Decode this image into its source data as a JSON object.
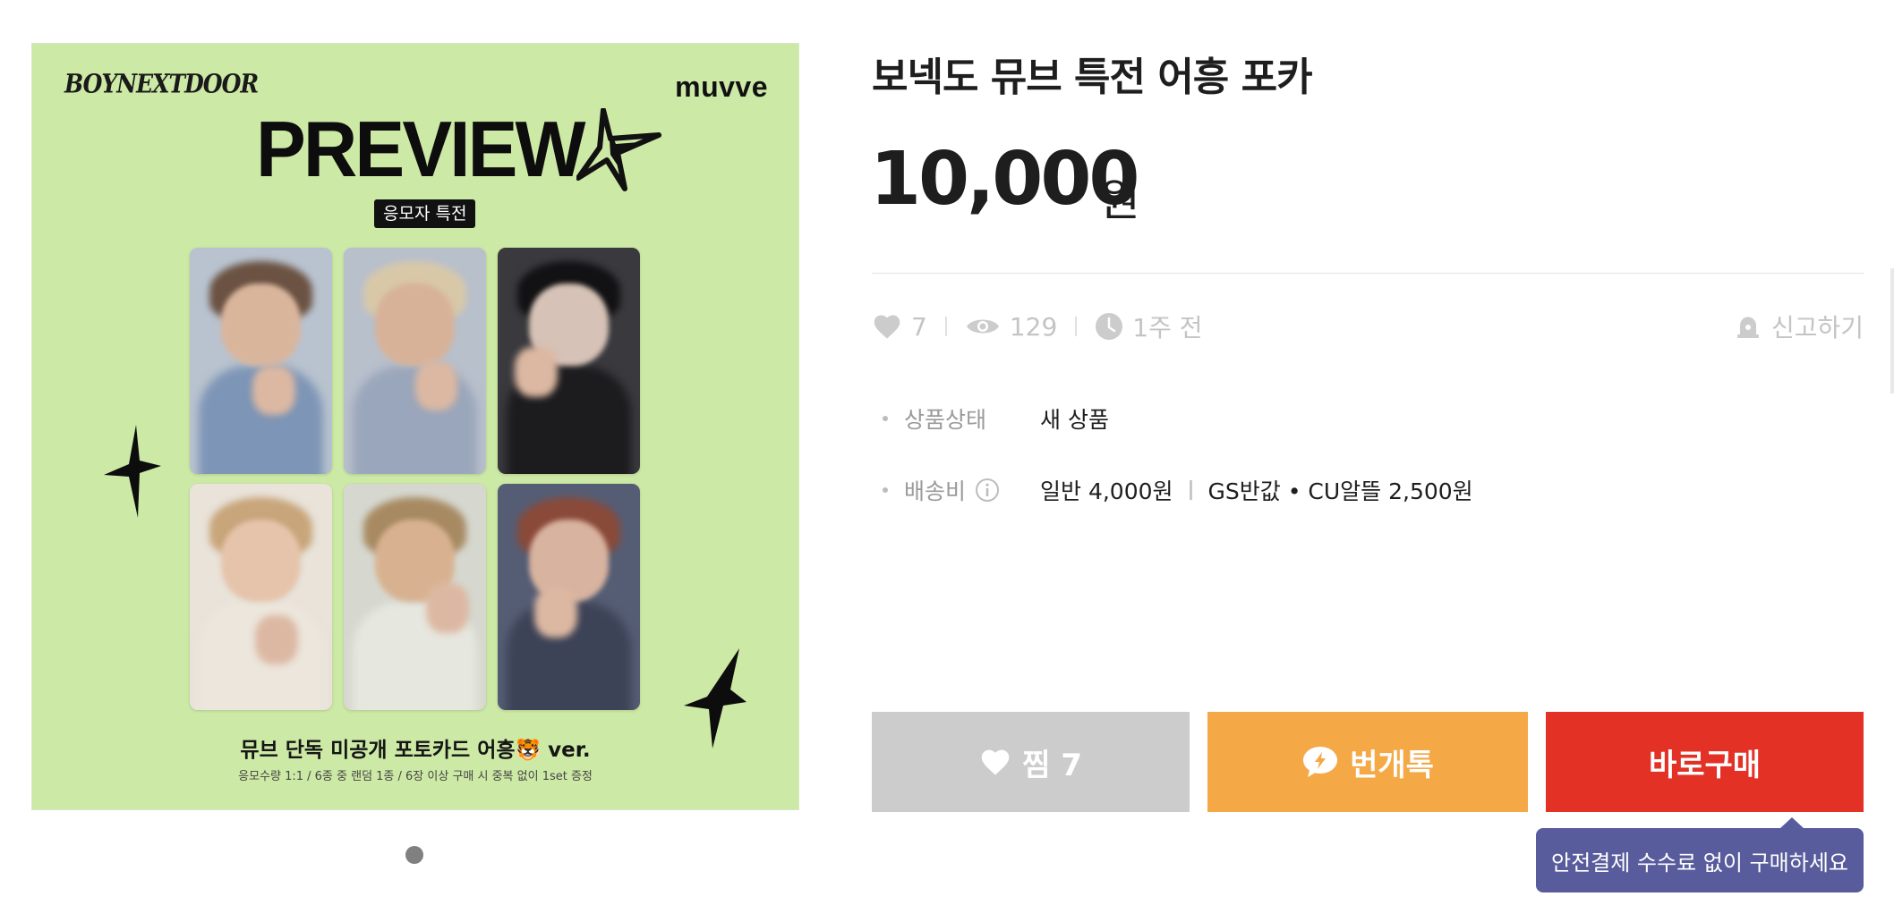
{
  "product_image": {
    "logo_left": "BOYNEXTDOOR",
    "logo_right": "muvve",
    "headline": "PREVIEW",
    "badge": "응모자 특전",
    "caption": "뮤브 단독 미공개 포토카드 어흥🐯 ver.",
    "subcaption": "응모수량  1:1 / 6종 중 랜덤 1종 / 6장 이상 구매 시 중복 없이 1set 증정",
    "background_color": "#cde9a6",
    "carousel_pages": 1
  },
  "product": {
    "title": "보넥도 뮤브 특전 어흥 포카",
    "price": "10,000",
    "price_unit": "원"
  },
  "stats": {
    "likes": "7",
    "views": "129",
    "time": "1주 전",
    "report_label": "신고하기"
  },
  "details": {
    "condition_label": "상품상태",
    "condition_value": "새 상품",
    "shipping_label": "배송비",
    "shipping_normal": "일반 4,000원",
    "shipping_convenience": "GS반값 • CU알뜰 2,500원"
  },
  "buttons": {
    "like_label": "찜 7",
    "talk_label": "번개톡",
    "buy_label": "바로구매"
  },
  "tooltip": {
    "text": "안전결제 수수료 없이 구매하세요"
  },
  "colors": {
    "like_button": "#cccccc",
    "talk_button": "#f4a946",
    "buy_button": "#e33126",
    "tooltip": "#595c9c"
  }
}
